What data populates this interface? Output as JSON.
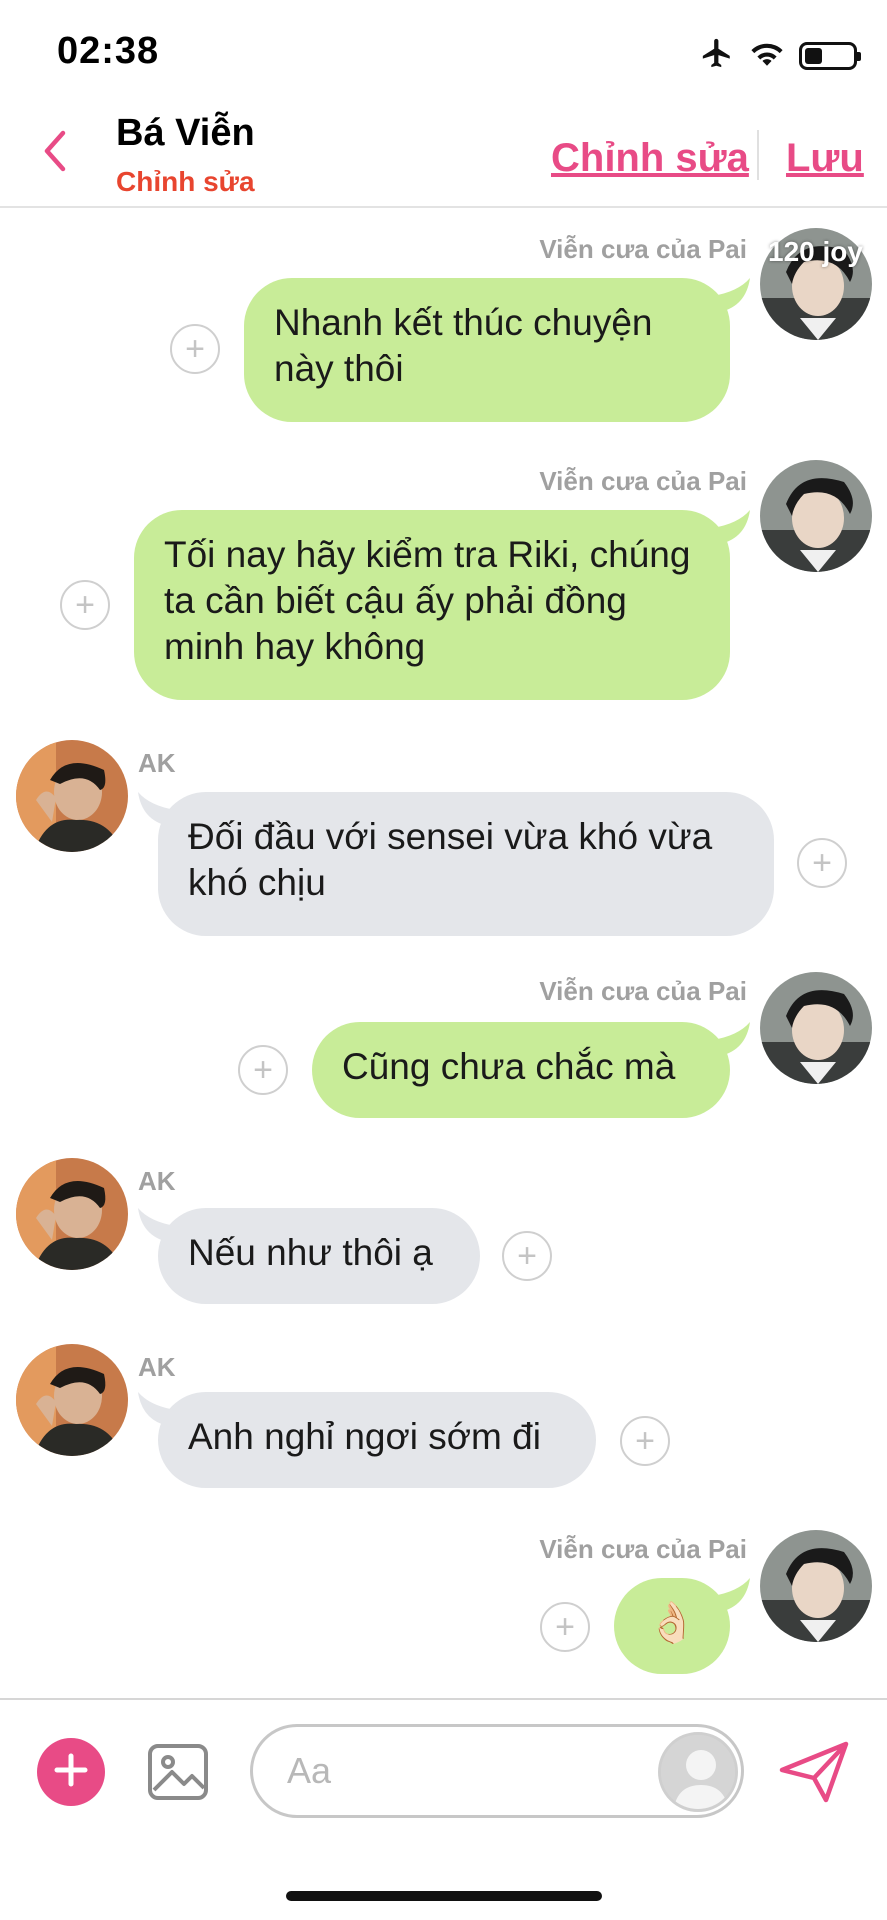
{
  "status_bar": {
    "time": "02:38",
    "icons": [
      "airplane-icon",
      "wifi-icon",
      "battery-icon"
    ],
    "battery_level": 0.38
  },
  "header": {
    "back_icon": "chevron-left-icon",
    "contact_name": "Bá Viễn",
    "subtitle": "Chỉnh sửa",
    "edit_link": "Chỉnh sửa",
    "save_link": "Lưu"
  },
  "colors": {
    "accent": "#e84b86",
    "subtitle": "#e8452f",
    "my_bubble": "#c8ec98",
    "their_bubble": "#e4e6ea"
  },
  "messages": [
    {
      "side": "right",
      "sender": "Viễn cưa của Pai",
      "text": "Nhanh kết thúc chuyện này thôi",
      "overlay_label": "120 joy"
    },
    {
      "side": "right",
      "sender": "Viễn cưa của Pai",
      "text": "Tối nay hãy kiểm tra Riki, chúng ta cần biết cậu ấy phải đồng minh hay không"
    },
    {
      "side": "left",
      "sender": "AK",
      "text": "Đối đầu với sensei vừa khó vừa khó chịu"
    },
    {
      "side": "right",
      "sender": "Viễn cưa của Pai",
      "text": "Cũng chưa chắc mà"
    },
    {
      "side": "left",
      "sender": "AK",
      "text": "Nếu như thôi ạ"
    },
    {
      "side": "left",
      "sender": "AK",
      "text": "Anh nghỉ ngơi sớm đi"
    },
    {
      "side": "right",
      "sender": "Viễn cưa của Pai",
      "text": "👌🏻"
    }
  ],
  "input_bar": {
    "placeholder": "Aa",
    "plus_icon": "plus-icon",
    "image_icon": "image-icon",
    "send_icon": "send-icon"
  }
}
